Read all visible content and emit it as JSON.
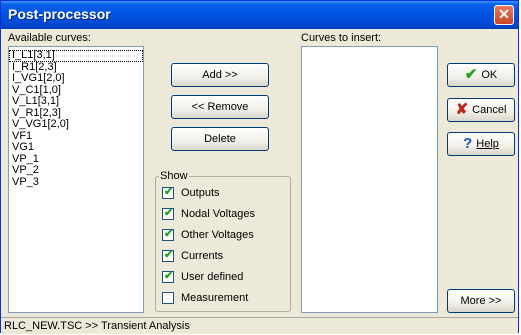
{
  "window": {
    "title": "Post-processor",
    "close_glyph": "✕"
  },
  "available": {
    "label": "Available curves:",
    "items": [
      "I_L1[3,1]",
      "I_R1[2,3]",
      "I_VG1[2,0]",
      "V_C1[1,0]",
      "V_L1[3,1]",
      "V_R1[2,3]",
      "V_VG1[2,0]",
      "VF1",
      "VG1",
      "VP_1",
      "VP_2",
      "VP_3"
    ]
  },
  "actions": {
    "add": "Add >>",
    "remove": "<< Remove",
    "delete": "Delete"
  },
  "insert": {
    "label": "Curves to insert:"
  },
  "show": {
    "legend": "Show",
    "options": [
      {
        "label": "Outputs",
        "checked": true
      },
      {
        "label": "Nodal Voltages",
        "checked": true
      },
      {
        "label": "Other Voltages",
        "checked": true
      },
      {
        "label": "Currents",
        "checked": true
      },
      {
        "label": "User defined",
        "checked": true
      },
      {
        "label": "Measurement",
        "checked": false
      }
    ]
  },
  "dialog_buttons": {
    "ok": "OK",
    "ok_icon": "check-icon",
    "ok_color": "#21a121",
    "cancel": "Cancel",
    "cancel_icon": "x-icon",
    "cancel_color": "#c0271b",
    "help": "Help",
    "help_icon": "question-icon",
    "help_color": "#1b52c4",
    "more": "More >>"
  },
  "status": {
    "text": "RLC_NEW.TSC >> Transient Analysis"
  }
}
